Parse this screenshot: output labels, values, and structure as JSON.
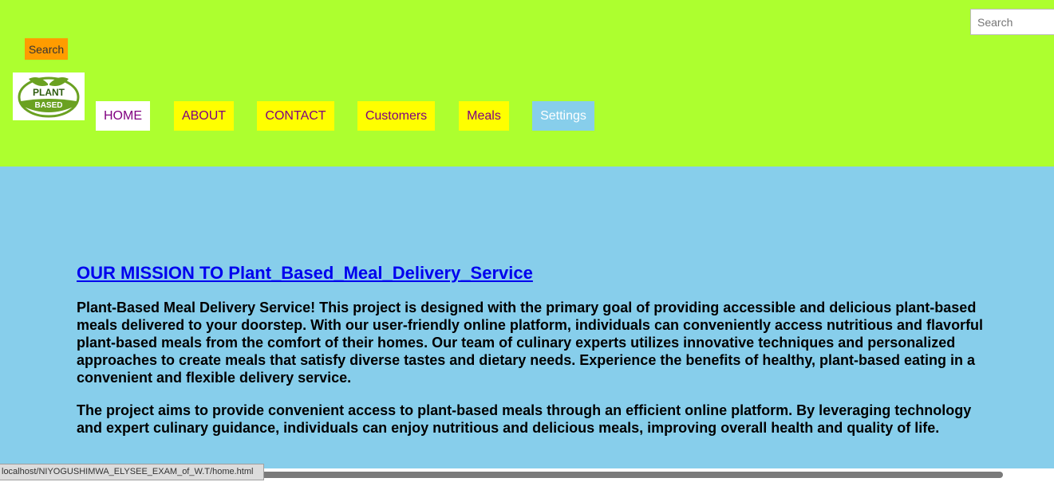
{
  "search": {
    "placeholder": "Search",
    "button_label": "Search"
  },
  "logo": {
    "icon": "plant-leaf-logo",
    "text_line1": "PLANT",
    "text_line2": "BASED"
  },
  "nav": {
    "items": [
      {
        "label": "HOME"
      },
      {
        "label": "ABOUT"
      },
      {
        "label": "CONTACT"
      },
      {
        "label": "Customers"
      },
      {
        "label": "Meals"
      },
      {
        "label": "Settings"
      }
    ]
  },
  "main": {
    "title": "OUR MISSION TO Plant_Based_Meal_Delivery_Service",
    "paragraph_1": "Plant-Based Meal Delivery Service! This project is designed with the primary goal of providing accessible and delicious plant-based meals delivered to your doorstep. With our user-friendly online platform, individuals can conveniently access nutritious and flavorful plant-based meals from the comfort of their homes. Our team of culinary experts utilizes innovative techniques and personalized approaches to create meals that satisfy diverse tastes and dietary needs. Experience the benefits of healthy, plant-based eating in a convenient and flexible delivery service.",
    "paragraph_2": "The project aims to provide convenient access to plant-based meals through an efficient online platform. By leveraging technology and expert culinary guidance, individuals can enjoy nutritious and delicious meals, improving overall health and quality of life."
  },
  "status_bar": {
    "url": "localhost/NIYOGUSHIMWA_ELYSEE_EXAM_of_W.T/home.html"
  },
  "colors": {
    "header_bg": "#adff2f",
    "page_bg": "#87ceeb",
    "search_button_bg": "#ff9c00",
    "nav_bg": "#ffff00",
    "nav_text": "#800080",
    "title_link": "#0000ee"
  }
}
